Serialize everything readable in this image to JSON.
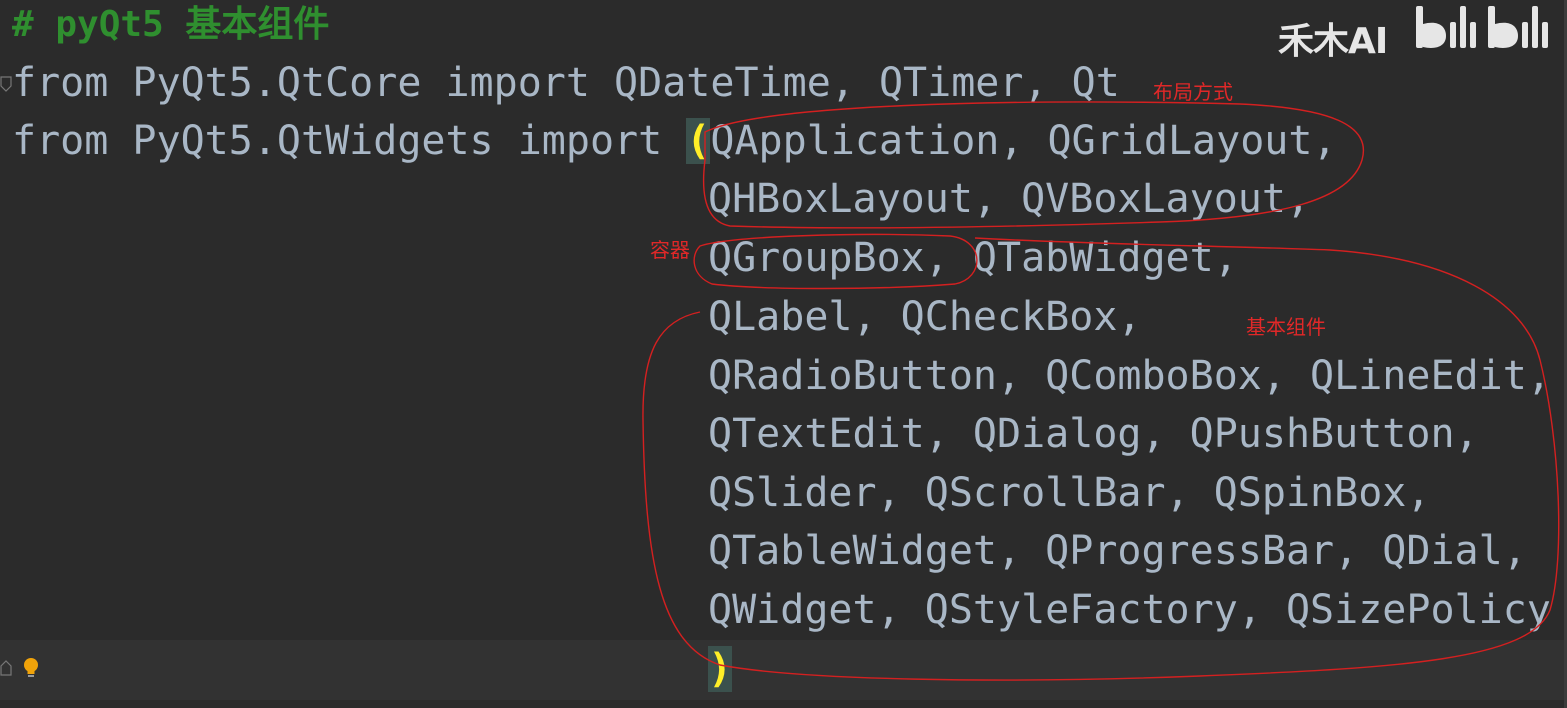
{
  "editor": {
    "comment_line": "# pyQt5 基本组件",
    "line1": "from PyQt5.QtCore import QDateTime, QTimer, Qt",
    "line2_prefix": "from PyQt5.QtWidgets import ",
    "open_paren": "(",
    "line2_rest": "QApplication, QGridLayout,",
    "continuation_lines": [
      "QHBoxLayout, QVBoxLayout,",
      "QGroupBox, QTabWidget,",
      "QLabel, QCheckBox,",
      "QRadioButton, QComboBox, QLineEdit,",
      "QTextEdit, QDialog, QPushButton,",
      "QSlider, QScrollBar, QSpinBox,",
      "QTableWidget, QProgressBar, QDial,",
      "QWidget, QStyleFactory, QSizePolicy"
    ],
    "close_paren": ")",
    "bulb_icon": "lightbulb-icon"
  },
  "annotations": {
    "layout": "布局方式",
    "container": "容器",
    "basic": "基本组件"
  },
  "watermark": {
    "text": "禾木AI",
    "logo_icon": "bilibili-logo-icon"
  },
  "colors": {
    "background": "#2b2b2b",
    "comment": "#2f8f2f",
    "code_text": "#a9b7c6",
    "paren_highlight": "#ffef28",
    "annotation": "#e02828"
  }
}
